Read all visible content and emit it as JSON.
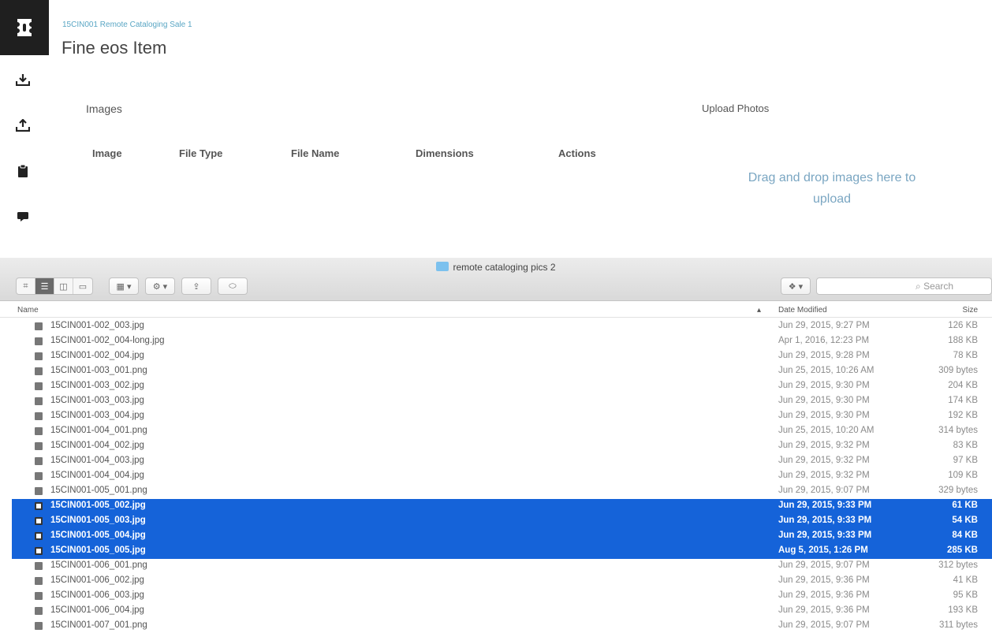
{
  "breadcrumb": "15CIN001 Remote Cataloging Sale 1",
  "page_title": "Fine eos Item",
  "images_section": {
    "title": "Images",
    "columns": [
      "Image",
      "File Type",
      "File Name",
      "Dimensions",
      "Actions"
    ]
  },
  "upload_section": {
    "title": "Upload Photos",
    "dropzone_text": "Drag and drop images here to upload"
  },
  "sidebar": {
    "icons": [
      "logo-icon",
      "download-icon",
      "upload-icon",
      "clipboard-icon",
      "comment-icon"
    ]
  },
  "finder": {
    "folder_name": "remote cataloging pics 2",
    "search_placeholder": "Search",
    "columns": {
      "name": "Name",
      "date": "Date Modified",
      "size": "Size"
    },
    "selection_color": "#1563d9",
    "files": [
      {
        "name": "15CIN001-002_003.jpg",
        "date": "Jun 29, 2015, 9:27 PM",
        "size": "126 KB",
        "selected": false
      },
      {
        "name": "15CIN001-002_004-long.jpg",
        "date": "Apr 1, 2016, 12:23 PM",
        "size": "188 KB",
        "selected": false
      },
      {
        "name": "15CIN001-002_004.jpg",
        "date": "Jun 29, 2015, 9:28 PM",
        "size": "78 KB",
        "selected": false
      },
      {
        "name": "15CIN001-003_001.png",
        "date": "Jun 25, 2015, 10:26 AM",
        "size": "309 bytes",
        "selected": false
      },
      {
        "name": "15CIN001-003_002.jpg",
        "date": "Jun 29, 2015, 9:30 PM",
        "size": "204 KB",
        "selected": false
      },
      {
        "name": "15CIN001-003_003.jpg",
        "date": "Jun 29, 2015, 9:30 PM",
        "size": "174 KB",
        "selected": false
      },
      {
        "name": "15CIN001-003_004.jpg",
        "date": "Jun 29, 2015, 9:30 PM",
        "size": "192 KB",
        "selected": false
      },
      {
        "name": "15CIN001-004_001.png",
        "date": "Jun 25, 2015, 10:20 AM",
        "size": "314 bytes",
        "selected": false
      },
      {
        "name": "15CIN001-004_002.jpg",
        "date": "Jun 29, 2015, 9:32 PM",
        "size": "83 KB",
        "selected": false
      },
      {
        "name": "15CIN001-004_003.jpg",
        "date": "Jun 29, 2015, 9:32 PM",
        "size": "97 KB",
        "selected": false
      },
      {
        "name": "15CIN001-004_004.jpg",
        "date": "Jun 29, 2015, 9:32 PM",
        "size": "109 KB",
        "selected": false
      },
      {
        "name": "15CIN001-005_001.png",
        "date": "Jun 29, 2015, 9:07 PM",
        "size": "329 bytes",
        "selected": false
      },
      {
        "name": "15CIN001-005_002.jpg",
        "date": "Jun 29, 2015, 9:33 PM",
        "size": "61 KB",
        "selected": true
      },
      {
        "name": "15CIN001-005_003.jpg",
        "date": "Jun 29, 2015, 9:33 PM",
        "size": "54 KB",
        "selected": true
      },
      {
        "name": "15CIN001-005_004.jpg",
        "date": "Jun 29, 2015, 9:33 PM",
        "size": "84 KB",
        "selected": true
      },
      {
        "name": "15CIN001-005_005.jpg",
        "date": "Aug 5, 2015, 1:26 PM",
        "size": "285 KB",
        "selected": true
      },
      {
        "name": "15CIN001-006_001.png",
        "date": "Jun 29, 2015, 9:07 PM",
        "size": "312 bytes",
        "selected": false
      },
      {
        "name": "15CIN001-006_002.jpg",
        "date": "Jun 29, 2015, 9:36 PM",
        "size": "41 KB",
        "selected": false
      },
      {
        "name": "15CIN001-006_003.jpg",
        "date": "Jun 29, 2015, 9:36 PM",
        "size": "95 KB",
        "selected": false
      },
      {
        "name": "15CIN001-006_004.jpg",
        "date": "Jun 29, 2015, 9:36 PM",
        "size": "193 KB",
        "selected": false
      },
      {
        "name": "15CIN001-007_001.png",
        "date": "Jun 29, 2015, 9:07 PM",
        "size": "311 bytes",
        "selected": false
      }
    ]
  }
}
